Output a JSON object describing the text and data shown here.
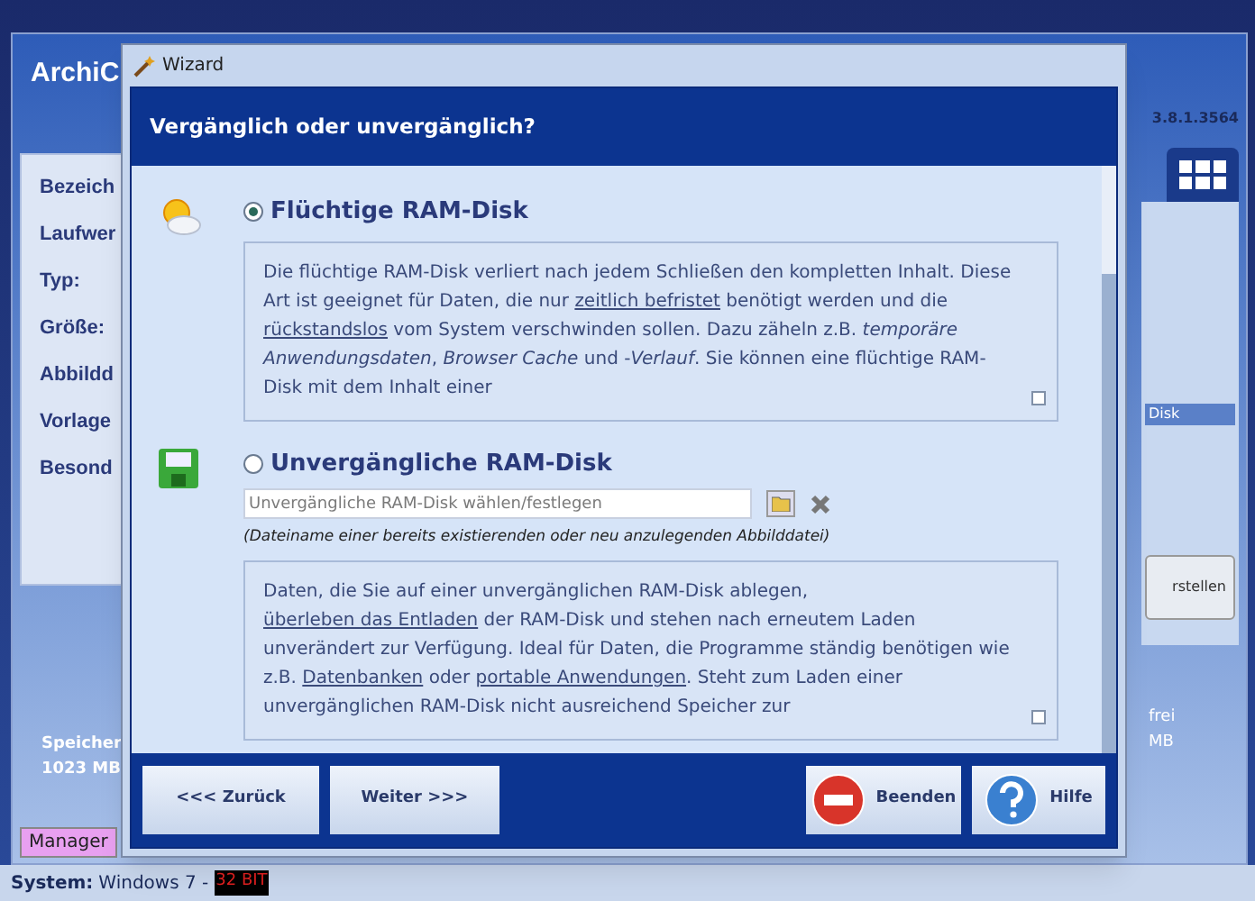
{
  "app": {
    "title": "ArchiC",
    "version": "3.8.1.3564",
    "fields": [
      "Bezeich",
      "Laufwer",
      "Typ:",
      "Größe:",
      "Abbildd",
      "Vorlage",
      "Besond"
    ],
    "memory": {
      "label": "Speicher",
      "value": "1023 MB"
    },
    "right_panel": {
      "row_label": "Disk",
      "button": "rstellen",
      "free_label": "frei",
      "free_value": "MB"
    },
    "manager_tab": "Manager",
    "status_bar": {
      "label": "System:",
      "value": "Windows 7 -",
      "badge": "32 BIT"
    }
  },
  "wizard": {
    "title": "Wizard",
    "heading": "Vergänglich oder unvergänglich?",
    "options": [
      {
        "kind": "volatile",
        "label": "Flüchtige RAM-Disk",
        "selected": true,
        "segments": [
          {
            "text": "Die flüchtige RAM-Disk verliert nach jedem Schließen den kompletten Inhalt. Diese Art ist geeignet für Daten, die nur ",
            "link": false
          },
          {
            "text": "zeitlich befristet",
            "link": true
          },
          {
            "text": " benötigt werden und die ",
            "link": false
          },
          {
            "text": "rückstandslos",
            "link": true
          },
          {
            "text": " vom System verschwinden sollen. Dazu zäheln z.B. *temporäre Anwendungsdaten*, *Browser Cache* und -*Verlauf*. Sie können eine flüchtige RAM-Disk mit dem Inhalt einer",
            "link": false
          }
        ]
      },
      {
        "kind": "persistent",
        "label": "Unvergängliche RAM-Disk",
        "selected": false,
        "placeholder": "Unvergängliche RAM-Disk wählen/festlegen",
        "hint": "(Dateiname einer bereits existierenden oder neu anzulegenden Abbilddatei)",
        "segments": [
          {
            "text": "Daten, die Sie auf einer unvergänglichen RAM-Disk ablegen, ",
            "link": false
          },
          {
            "text": "überleben das Entladen",
            "link": true
          },
          {
            "text": " der RAM-Disk und stehen nach erneutem Laden unverändert zur Verfügung. Ideal für Daten, die Programme ständig benötigen wie z.B. ",
            "link": false
          },
          {
            "text": "Datenbanken",
            "link": true
          },
          {
            "text": " oder ",
            "link": false
          },
          {
            "text": "portable Anwendungen",
            "link": true
          },
          {
            "text": ". Steht zum Laden einer unvergänglichen RAM-Disk nicht ausreichend Speicher zur",
            "link": false
          }
        ]
      }
    ],
    "buttons": [
      {
        "kind": "back",
        "label": "<<< Zurück"
      },
      {
        "kind": "next",
        "label": "Weiter >>>"
      },
      {
        "kind": "quit",
        "label": "Beenden"
      },
      {
        "kind": "help",
        "label": "Hilfe"
      }
    ]
  }
}
